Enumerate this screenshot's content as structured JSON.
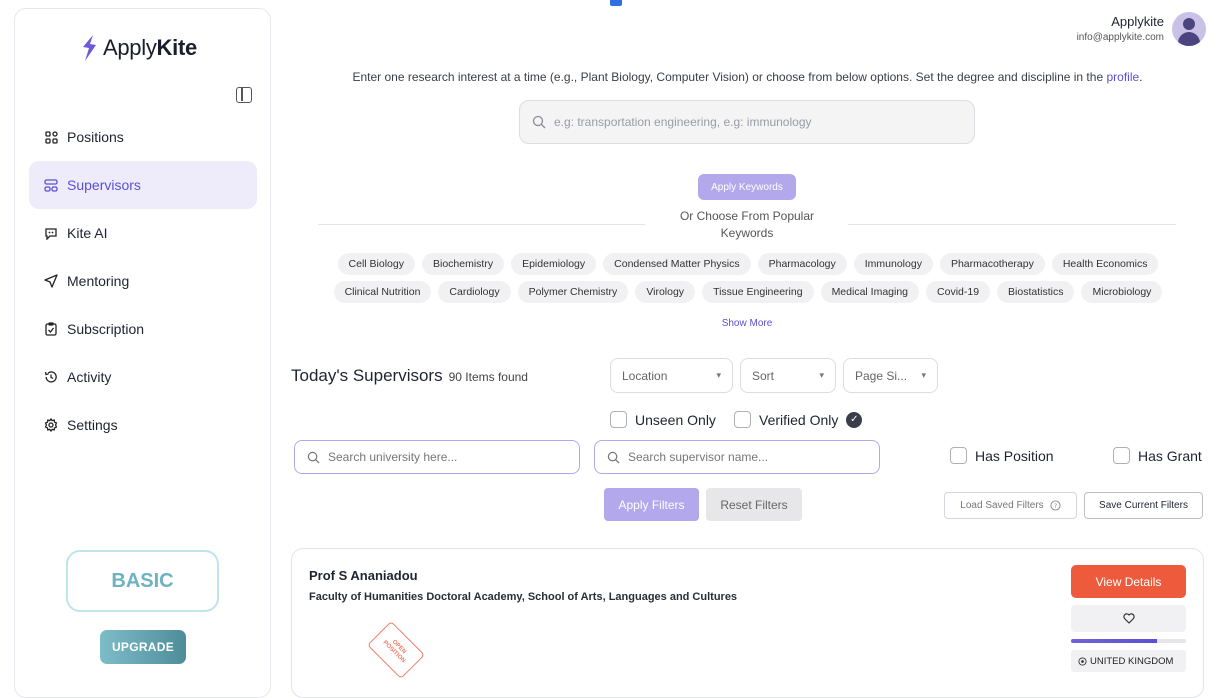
{
  "brand": {
    "prefix": "Apply",
    "suffix": "Kite"
  },
  "user": {
    "name": "Applykite",
    "email": "info@applykite.com"
  },
  "sidebar": {
    "items": [
      {
        "label": "Positions",
        "icon": "grid-icon",
        "active": false
      },
      {
        "label": "Supervisors",
        "icon": "supervisors-icon",
        "active": true
      },
      {
        "label": "Kite AI",
        "icon": "chat-bot-icon",
        "active": false
      },
      {
        "label": "Mentoring",
        "icon": "send-icon",
        "active": false
      },
      {
        "label": "Subscription",
        "icon": "clipboard-check-icon",
        "active": false
      },
      {
        "label": "Activity",
        "icon": "history-icon",
        "active": false
      },
      {
        "label": "Settings",
        "icon": "gear-icon",
        "active": false
      }
    ],
    "plan": "BASIC",
    "upgrade_label": "UPGRADE"
  },
  "intro": {
    "text": "Enter one research interest at a time (e.g., Plant Biology, Computer Vision) or choose from below options. Set the degree and discipline in the",
    "link": "profile",
    "suffix": "."
  },
  "keyword_search": {
    "placeholder": "e.g: transportation engineering, e.g: immunology"
  },
  "apply_keywords_label": "Apply Keywords",
  "popular_label": "Or Choose From Popular Keywords",
  "keywords_row1": [
    "Cell Biology",
    "Biochemistry",
    "Epidemiology",
    "Condensed Matter Physics",
    "Pharmacology",
    "Immunology",
    "Pharmacotherapy",
    "Health Economics"
  ],
  "keywords_row2": [
    "Clinical Nutrition",
    "Cardiology",
    "Polymer Chemistry",
    "Virology",
    "Tissue Engineering",
    "Medical Imaging",
    "Covid-19",
    "Biostatistics",
    "Microbiology"
  ],
  "show_more_label": "Show More",
  "results": {
    "title": "Today's Supervisors",
    "count": "90 Items found"
  },
  "filters": {
    "location": "Location",
    "sort": "Sort",
    "page_size": "Page Si...",
    "unseen_only": "Unseen Only",
    "verified_only": "Verified Only",
    "university_placeholder": "Search university here...",
    "supervisor_placeholder": "Search supervisor name...",
    "has_position": "Has Position",
    "has_grant": "Has Grant",
    "apply_label": "Apply Filters",
    "reset_label": "Reset Filters",
    "load_saved_label": "Load Saved Filters",
    "save_current_label": "Save Current Filters"
  },
  "supervisor": {
    "name": "Prof S Ananiadou",
    "department": "Faculty of Humanities Doctoral Academy, School of Arts, Languages and Cultures",
    "stamp": "OPEN POSITION",
    "view_label": "View Details",
    "country": "UNITED KINGDOM",
    "progress": 0.75
  },
  "colors": {
    "accent": "#5b4fd6",
    "accent_light": "#b3a8ec",
    "view_button": "#ee5a3c",
    "plan": "#6db3c2"
  }
}
